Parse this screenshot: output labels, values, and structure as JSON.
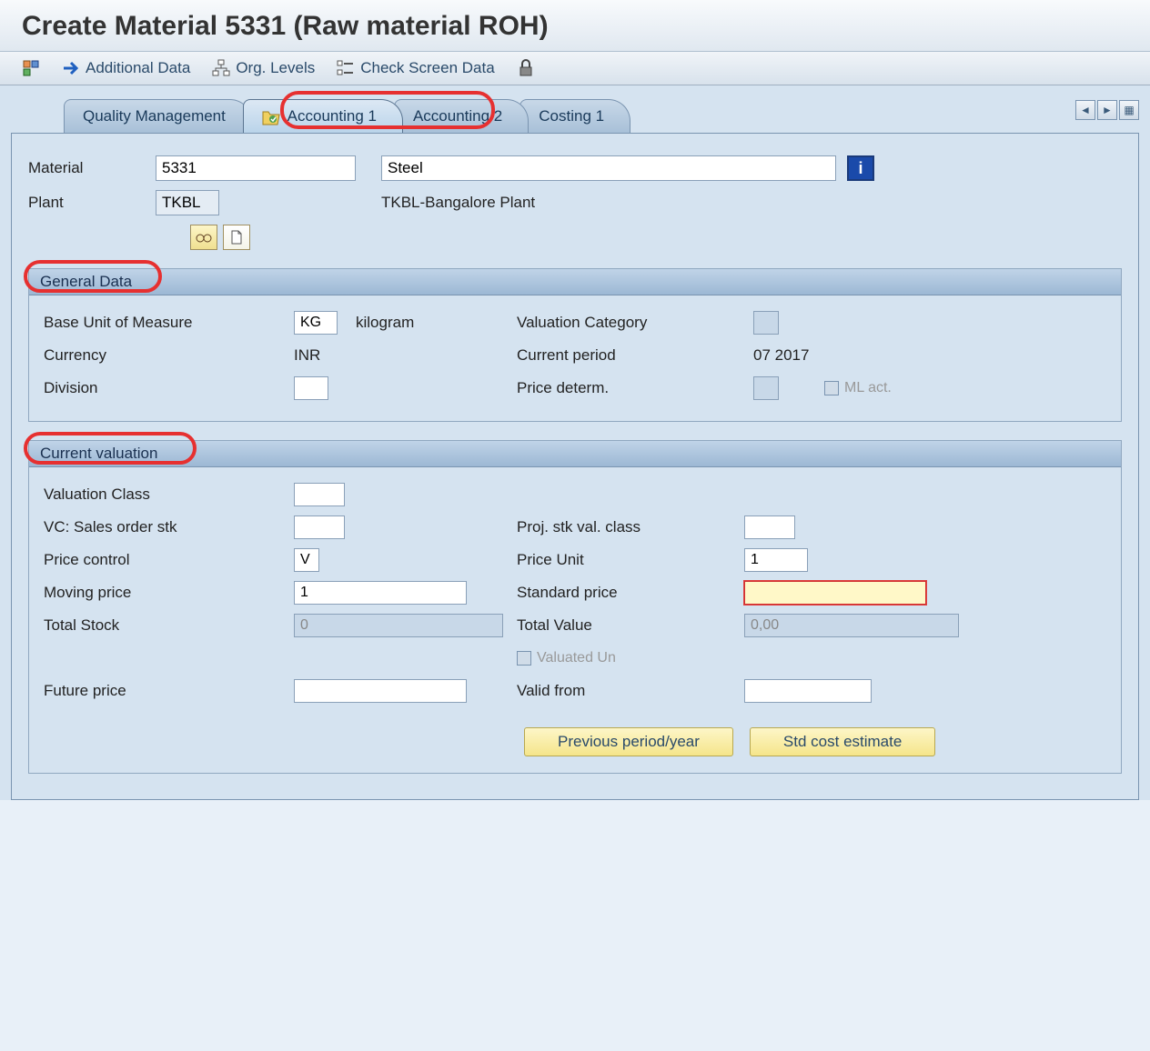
{
  "title": "Create Material 5331 (Raw material ROH)",
  "toolbar": {
    "additional_data": "Additional Data",
    "org_levels": "Org. Levels",
    "check_screen": "Check Screen Data"
  },
  "tabs": [
    {
      "label": "Quality Management"
    },
    {
      "label": "Accounting 1"
    },
    {
      "label": "Accounting 2"
    },
    {
      "label": "Costing 1"
    }
  ],
  "header": {
    "material_label": "Material",
    "material_value": "5331",
    "material_desc": "Steel",
    "plant_label": "Plant",
    "plant_value": "TKBL",
    "plant_desc": "TKBL-Bangalore Plant"
  },
  "general": {
    "title": "General Data",
    "base_uom_label": "Base Unit of Measure",
    "base_uom_value": "KG",
    "base_uom_text": "kilogram",
    "valuation_cat_label": "Valuation Category",
    "currency_label": "Currency",
    "currency_value": "INR",
    "current_period_label": "Current period",
    "current_period_value": "07 2017",
    "division_label": "Division",
    "price_determ_label": "Price determ.",
    "ml_act_label": "ML act."
  },
  "valuation": {
    "title": "Current valuation",
    "val_class_label": "Valuation Class",
    "vc_sales_label": "VC: Sales order stk",
    "proj_stk_label": "Proj. stk val. class",
    "price_control_label": "Price control",
    "price_control_value": "V",
    "price_unit_label": "Price Unit",
    "price_unit_value": "1",
    "moving_price_label": "Moving price",
    "moving_price_value": "1",
    "standard_price_label": "Standard price",
    "total_stock_label": "Total Stock",
    "total_stock_value": "0",
    "total_value_label": "Total Value",
    "total_value_value": "0,00",
    "valuated_un_label": "Valuated Un",
    "future_price_label": "Future price",
    "valid_from_label": "Valid from",
    "prev_period_btn": "Previous period/year",
    "std_cost_btn": "Std cost estimate"
  }
}
